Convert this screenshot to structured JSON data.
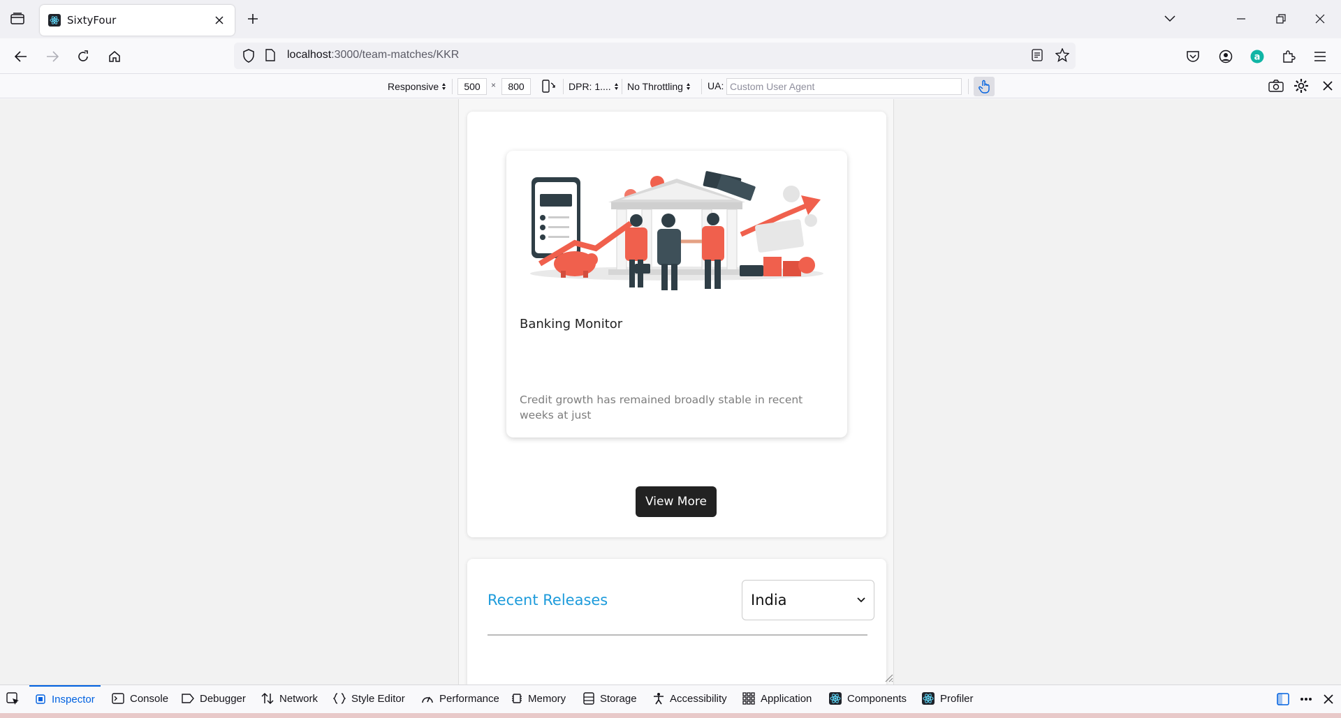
{
  "browser": {
    "tab_title": "SixtyFour",
    "url_host": "localhost",
    "url_path": ":3000/team-matches/KKR"
  },
  "rdm": {
    "device": "Responsive",
    "width": "500",
    "times": "×",
    "height": "800",
    "dpr": "DPR: 1....",
    "throttling": "No Throttling",
    "ua_label": "UA:",
    "ua_placeholder": "Custom User Agent"
  },
  "page": {
    "card": {
      "title": "Banking Monitor",
      "description": "Credit growth has remained broadly stable in recent weeks at just"
    },
    "view_more_label": "View More",
    "releases_title": "Recent Releases",
    "country_selected": "India"
  },
  "devtools": {
    "tabs": [
      "Inspector",
      "Console",
      "Debugger",
      "Network",
      "Style Editor",
      "Performance",
      "Memory",
      "Storage",
      "Accessibility",
      "Application",
      "Components",
      "Profiler"
    ]
  },
  "colors": {
    "accent_blue": "#1d9bdb",
    "button_dark": "#222222",
    "illustration_red": "#f0604d",
    "illustration_dark": "#2f3e46"
  }
}
